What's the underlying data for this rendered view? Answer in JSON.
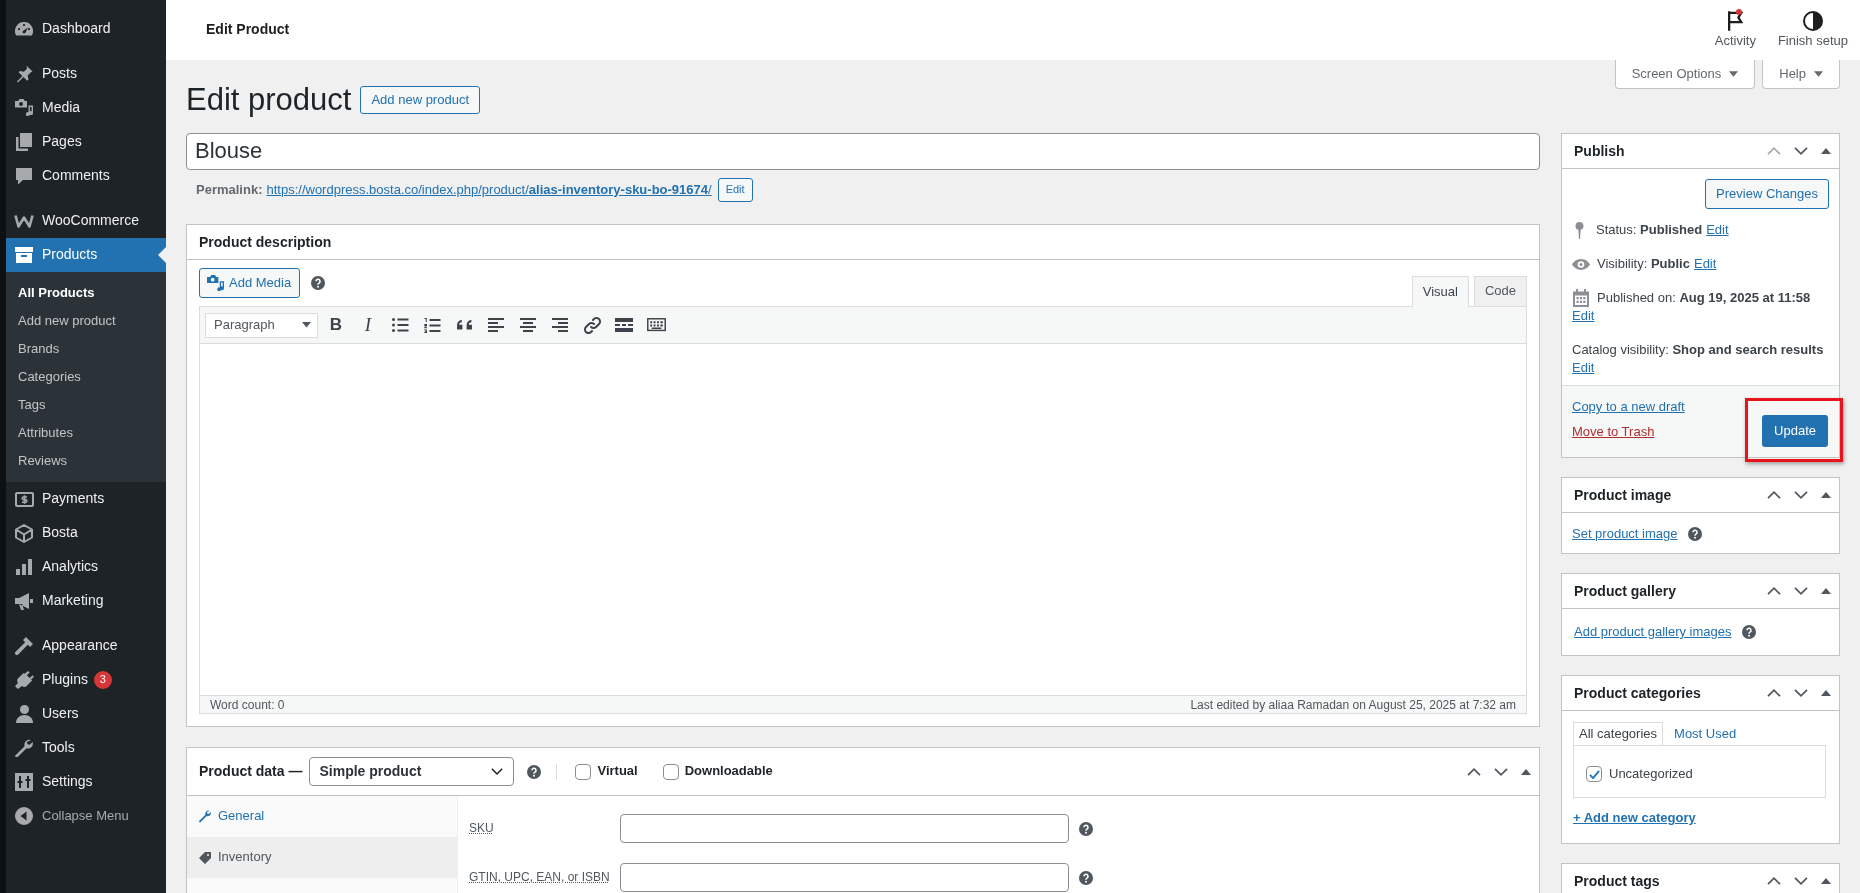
{
  "sidebar": {
    "groups": [
      {
        "items": [
          {
            "label": "Dashboard",
            "selected": false
          }
        ]
      },
      {
        "items": [
          {
            "label": "Posts",
            "selected": false
          },
          {
            "label": "Media",
            "selected": false
          },
          {
            "label": "Pages",
            "selected": false
          },
          {
            "label": "Comments",
            "selected": false
          }
        ]
      },
      {
        "items": [
          {
            "label": "WooCommerce",
            "selected": false
          },
          {
            "label": "Products",
            "selected": true,
            "submenu": [
              {
                "label": "All Products",
                "selected": true
              },
              {
                "label": "Add new product",
                "selected": false
              },
              {
                "label": "Brands",
                "selected": false
              },
              {
                "label": "Categories",
                "selected": false
              },
              {
                "label": "Tags",
                "selected": false
              },
              {
                "label": "Attributes",
                "selected": false
              },
              {
                "label": "Reviews",
                "selected": false
              }
            ]
          },
          {
            "label": "Payments",
            "selected": false
          },
          {
            "label": "Bosta",
            "selected": false
          },
          {
            "label": "Analytics",
            "selected": false
          },
          {
            "label": "Marketing",
            "selected": false
          }
        ]
      },
      {
        "items": [
          {
            "label": "Appearance",
            "selected": false
          },
          {
            "label": "Plugins",
            "selected": false,
            "badge": "3"
          },
          {
            "label": "Users",
            "selected": false
          },
          {
            "label": "Tools",
            "selected": false
          },
          {
            "label": "Settings",
            "selected": false
          }
        ]
      }
    ],
    "collapse": "Collapse Menu"
  },
  "topbar": {
    "title": "Edit Product",
    "actions": [
      {
        "label": "Activity",
        "unread": true
      },
      {
        "label": "Finish setup",
        "unread": false
      }
    ]
  },
  "screen_meta": [
    {
      "label": "Screen Options"
    },
    {
      "label": "Help"
    }
  ],
  "heading": {
    "title": "Edit product",
    "add_button": "Add new product"
  },
  "title_field": {
    "value": "Blouse"
  },
  "permalink": {
    "label": "Permalink:",
    "url": "https://wordpress.bosta.co/index.php/product/**alias-inventory-sku-bo-91674**/",
    "edit_button": "Edit"
  },
  "description": {
    "title": "Product description",
    "add_media": "Add Media",
    "editor_tabs": [
      {
        "label": "Visual",
        "selected": true
      },
      {
        "label": "Code",
        "selected": false
      }
    ],
    "format": "Paragraph",
    "toolbar": [
      {
        "kind": "bold",
        "label": "B"
      },
      {
        "kind": "italic",
        "label": "I"
      },
      {
        "kind": "bullet-list"
      },
      {
        "kind": "numbered-list"
      },
      {
        "kind": "quote"
      },
      {
        "kind": "align-left"
      },
      {
        "kind": "align-center"
      },
      {
        "kind": "align-right"
      },
      {
        "kind": "link"
      },
      {
        "kind": "read-more"
      },
      {
        "kind": "toolbar-toggle"
      }
    ],
    "word_count": "Word count: 0",
    "last_edited": "Last edited by aliaa Ramadan on August 25, 2025 at 7:32 am"
  },
  "product_data": {
    "title": "Product data —",
    "type": "Simple product",
    "options": [
      {
        "label": "Virtual",
        "checked": false
      },
      {
        "label": "Downloadable",
        "checked": false
      }
    ],
    "tabs": [
      {
        "label": "General",
        "selected": false
      },
      {
        "label": "Inventory",
        "selected": true
      }
    ],
    "fields": [
      {
        "label": "SKU"
      },
      {
        "label": "GTIN, UPC, EAN, or ISBN"
      }
    ]
  },
  "publish": {
    "title": "Publish",
    "move_up_disabled": true,
    "preview_button": "Preview Changes",
    "details": [
      {
        "text": "Status: **Published**",
        "edit": "Edit"
      },
      {
        "text": "Visibility: **Public**",
        "edit": "Edit"
      },
      {
        "text": "Published on: **Aug 19, 2025 at 11:58**",
        "edit": "Edit"
      },
      {
        "text": "Catalog visibility: **Shop and search results**",
        "edit": "Edit"
      }
    ],
    "copy_link": "Copy to a new draft",
    "trash_link": "Move to Trash",
    "update_button": "Update",
    "highlighted": true
  },
  "product_image": {
    "title": "Product image",
    "link": "Set product image"
  },
  "product_gallery": {
    "title": "Product gallery",
    "link": "Add product gallery images"
  },
  "product_categories": {
    "title": "Product categories",
    "tabs": [
      {
        "label": "All categories",
        "selected": true
      },
      {
        "label": "Most Used",
        "selected": false
      }
    ],
    "items": [
      {
        "label": "Uncategorized",
        "checked": true
      }
    ],
    "add_link": "+ Add new category"
  },
  "product_tags": {
    "title": "Product tags"
  }
}
